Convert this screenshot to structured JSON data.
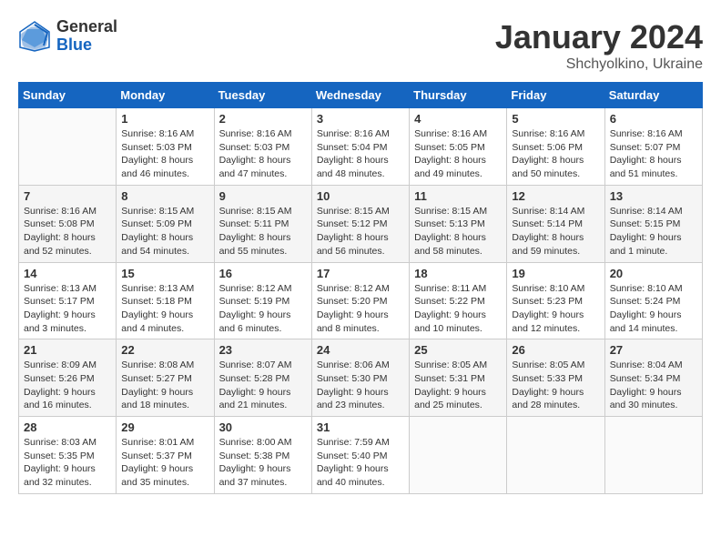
{
  "logo": {
    "general": "General",
    "blue": "Blue"
  },
  "title": "January 2024",
  "location": "Shchyolkino, Ukraine",
  "weekdays": [
    "Sunday",
    "Monday",
    "Tuesday",
    "Wednesday",
    "Thursday",
    "Friday",
    "Saturday"
  ],
  "weeks": [
    [
      {
        "day": "",
        "info": ""
      },
      {
        "day": "1",
        "info": "Sunrise: 8:16 AM\nSunset: 5:03 PM\nDaylight: 8 hours\nand 46 minutes."
      },
      {
        "day": "2",
        "info": "Sunrise: 8:16 AM\nSunset: 5:03 PM\nDaylight: 8 hours\nand 47 minutes."
      },
      {
        "day": "3",
        "info": "Sunrise: 8:16 AM\nSunset: 5:04 PM\nDaylight: 8 hours\nand 48 minutes."
      },
      {
        "day": "4",
        "info": "Sunrise: 8:16 AM\nSunset: 5:05 PM\nDaylight: 8 hours\nand 49 minutes."
      },
      {
        "day": "5",
        "info": "Sunrise: 8:16 AM\nSunset: 5:06 PM\nDaylight: 8 hours\nand 50 minutes."
      },
      {
        "day": "6",
        "info": "Sunrise: 8:16 AM\nSunset: 5:07 PM\nDaylight: 8 hours\nand 51 minutes."
      }
    ],
    [
      {
        "day": "7",
        "info": "Sunrise: 8:16 AM\nSunset: 5:08 PM\nDaylight: 8 hours\nand 52 minutes."
      },
      {
        "day": "8",
        "info": "Sunrise: 8:15 AM\nSunset: 5:09 PM\nDaylight: 8 hours\nand 54 minutes."
      },
      {
        "day": "9",
        "info": "Sunrise: 8:15 AM\nSunset: 5:11 PM\nDaylight: 8 hours\nand 55 minutes."
      },
      {
        "day": "10",
        "info": "Sunrise: 8:15 AM\nSunset: 5:12 PM\nDaylight: 8 hours\nand 56 minutes."
      },
      {
        "day": "11",
        "info": "Sunrise: 8:15 AM\nSunset: 5:13 PM\nDaylight: 8 hours\nand 58 minutes."
      },
      {
        "day": "12",
        "info": "Sunrise: 8:14 AM\nSunset: 5:14 PM\nDaylight: 8 hours\nand 59 minutes."
      },
      {
        "day": "13",
        "info": "Sunrise: 8:14 AM\nSunset: 5:15 PM\nDaylight: 9 hours\nand 1 minute."
      }
    ],
    [
      {
        "day": "14",
        "info": "Sunrise: 8:13 AM\nSunset: 5:17 PM\nDaylight: 9 hours\nand 3 minutes."
      },
      {
        "day": "15",
        "info": "Sunrise: 8:13 AM\nSunset: 5:18 PM\nDaylight: 9 hours\nand 4 minutes."
      },
      {
        "day": "16",
        "info": "Sunrise: 8:12 AM\nSunset: 5:19 PM\nDaylight: 9 hours\nand 6 minutes."
      },
      {
        "day": "17",
        "info": "Sunrise: 8:12 AM\nSunset: 5:20 PM\nDaylight: 9 hours\nand 8 minutes."
      },
      {
        "day": "18",
        "info": "Sunrise: 8:11 AM\nSunset: 5:22 PM\nDaylight: 9 hours\nand 10 minutes."
      },
      {
        "day": "19",
        "info": "Sunrise: 8:10 AM\nSunset: 5:23 PM\nDaylight: 9 hours\nand 12 minutes."
      },
      {
        "day": "20",
        "info": "Sunrise: 8:10 AM\nSunset: 5:24 PM\nDaylight: 9 hours\nand 14 minutes."
      }
    ],
    [
      {
        "day": "21",
        "info": "Sunrise: 8:09 AM\nSunset: 5:26 PM\nDaylight: 9 hours\nand 16 minutes."
      },
      {
        "day": "22",
        "info": "Sunrise: 8:08 AM\nSunset: 5:27 PM\nDaylight: 9 hours\nand 18 minutes."
      },
      {
        "day": "23",
        "info": "Sunrise: 8:07 AM\nSunset: 5:28 PM\nDaylight: 9 hours\nand 21 minutes."
      },
      {
        "day": "24",
        "info": "Sunrise: 8:06 AM\nSunset: 5:30 PM\nDaylight: 9 hours\nand 23 minutes."
      },
      {
        "day": "25",
        "info": "Sunrise: 8:05 AM\nSunset: 5:31 PM\nDaylight: 9 hours\nand 25 minutes."
      },
      {
        "day": "26",
        "info": "Sunrise: 8:05 AM\nSunset: 5:33 PM\nDaylight: 9 hours\nand 28 minutes."
      },
      {
        "day": "27",
        "info": "Sunrise: 8:04 AM\nSunset: 5:34 PM\nDaylight: 9 hours\nand 30 minutes."
      }
    ],
    [
      {
        "day": "28",
        "info": "Sunrise: 8:03 AM\nSunset: 5:35 PM\nDaylight: 9 hours\nand 32 minutes."
      },
      {
        "day": "29",
        "info": "Sunrise: 8:01 AM\nSunset: 5:37 PM\nDaylight: 9 hours\nand 35 minutes."
      },
      {
        "day": "30",
        "info": "Sunrise: 8:00 AM\nSunset: 5:38 PM\nDaylight: 9 hours\nand 37 minutes."
      },
      {
        "day": "31",
        "info": "Sunrise: 7:59 AM\nSunset: 5:40 PM\nDaylight: 9 hours\nand 40 minutes."
      },
      {
        "day": "",
        "info": ""
      },
      {
        "day": "",
        "info": ""
      },
      {
        "day": "",
        "info": ""
      }
    ]
  ]
}
